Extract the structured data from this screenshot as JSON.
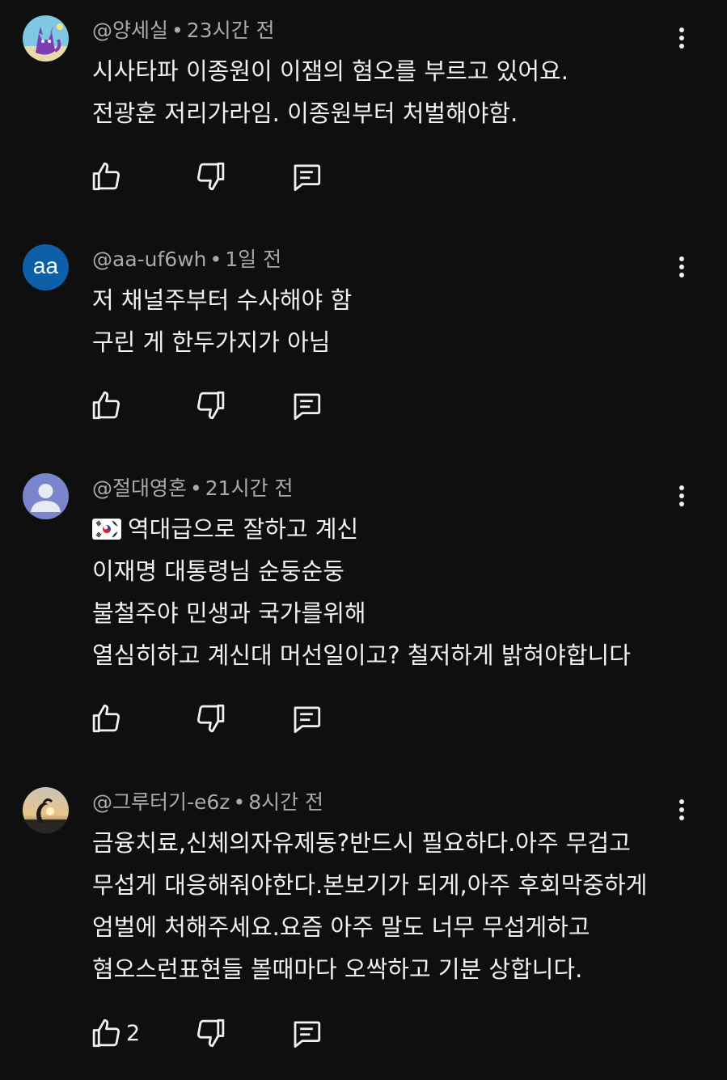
{
  "comments": [
    {
      "author": "@양세실",
      "time": "23시간 전",
      "avatar": "fox-cat-avatar",
      "lines": [
        "시사타파 이종원이 이잼의  혐오를 부르고 있어요.",
        "전광훈 저리가라임.  이종원부터  처벌해야함."
      ],
      "likes": ""
    },
    {
      "author": "@aa-uf6wh",
      "time": "1일 전",
      "avatar_text": "aa",
      "lines": [
        "저 채널주부터 수사해야 함",
        "구린 게 한두가지가 아님"
      ],
      "likes": ""
    },
    {
      "author": "@절대영혼",
      "time": "21시간 전",
      "avatar": "default-person-avatar",
      "flag": "south-korea-flag-icon",
      "lines": [
        "역대급으로 잘하고 계신",
        "이재명 대통령님 순둥순둥",
        "불철주야 민생과 국가를위해",
        "열심히하고 계신대 머선일이고? 철저하게 밝혀야합니다"
      ],
      "likes": ""
    },
    {
      "author": "@그루터기-e6z",
      "time": "8시간 전",
      "avatar": "sunset-sculpture-avatar",
      "lines": [
        "금융치료,신체의자유제동?반드시 필요하다.아주 무겁고",
        "무섭게 대응해줘야한다.본보기가 되게,아주 후회막중하게",
        "엄벌에 처해주세요.요즘 아주 말도 너무 무섭게하고",
        "혐오스런표현들 볼때마다 오싹하고 기분 상합니다."
      ],
      "likes": "2"
    }
  ],
  "colors": {
    "background": "#0f0f0f",
    "text": "#f1f1f1",
    "meta": "#aaaaaa",
    "aa_avatar": "#0d5fa8",
    "person_avatar": "#7986cb"
  },
  "icons": {
    "like": "thumbs-up-icon",
    "dislike": "thumbs-down-icon",
    "reply": "reply-comment-icon",
    "menu": "more-vert-icon"
  }
}
